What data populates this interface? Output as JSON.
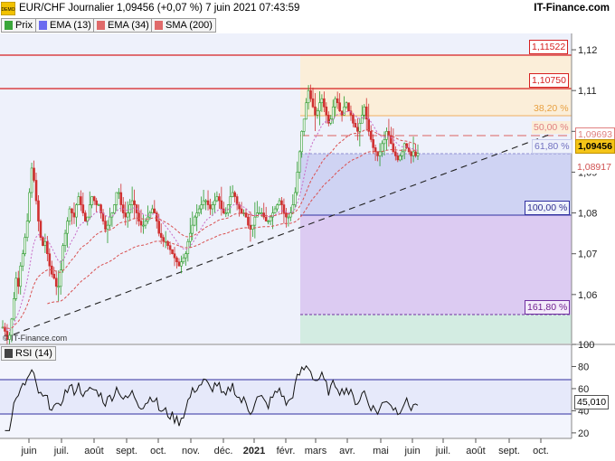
{
  "header": {
    "title": "EUR/CHF Journalier 1,09456 (+0,07 %) 7 juin 2021 07:43:59",
    "brand": "IT-Finance.com",
    "logo_text": "DEMO",
    "watermark": "© IT-Finance.com"
  },
  "legend": [
    {
      "label": "Prix",
      "color": "#3aa63a"
    },
    {
      "label": "EMA (13)",
      "color": "#6a6af0"
    },
    {
      "label": "EMA (34)",
      "color": "#e06a6a"
    },
    {
      "label": "SMA (200)",
      "color": "#e06a6a"
    }
  ],
  "rsi_legend": {
    "label": "RSI (14)"
  },
  "price_labels": {
    "high_1": "1,11522",
    "high_2": "1,10750",
    "fib_38": "38,20 %",
    "fib_50": "50,00 %",
    "fib_50_value": "1,09693",
    "fib_618": "61,80 %",
    "last_price": "1,09456",
    "sma_value": "1,08917",
    "fib_100": "100,00 %",
    "fib_1618": "161,80 %",
    "rsi_value": "45,010"
  },
  "chart_data": [
    {
      "type": "candlestick",
      "title": "EUR/CHF Journalier",
      "ylim": [
        1.048,
        1.124
      ],
      "y_ticks": [
        "1,12",
        "1,11",
        "1,1",
        "1,09",
        "1,08",
        "1,07",
        "1,06"
      ],
      "x_ticks": [
        "juin",
        "juil.",
        "août",
        "sept.",
        "oct.",
        "nov.",
        "déc.",
        "2021",
        "févr.",
        "mars",
        "avr.",
        "mai",
        "juin",
        "juil.",
        "août",
        "sept.",
        "oct."
      ],
      "horizontal_levels": [
        {
          "name": "resistance-1",
          "value": 1.11522,
          "color": "#e03030"
        },
        {
          "name": "resistance-2",
          "value": 1.1075,
          "color": "#e03030"
        },
        {
          "name": "fib-38",
          "value": 1.1015,
          "color": "#f0b060"
        },
        {
          "name": "fib-50",
          "value": 1.09693,
          "color": "#e08080"
        },
        {
          "name": "fib-61.8",
          "value": 1.0937,
          "color": "#9090d0"
        },
        {
          "name": "fib-100",
          "value": 1.0789,
          "color": "#4040a0"
        },
        {
          "name": "fib-161.8",
          "value": 1.0553,
          "color": "#8040a0"
        }
      ],
      "close_series": [
        1.052,
        1.051,
        1.049,
        1.05,
        1.054,
        1.059,
        1.064,
        1.062,
        1.067,
        1.07,
        1.074,
        1.078,
        1.085,
        1.091,
        1.088,
        1.083,
        1.078,
        1.074,
        1.072,
        1.073,
        1.07,
        1.067,
        1.065,
        1.064,
        1.062,
        1.062,
        1.066,
        1.072,
        1.075,
        1.078,
        1.081,
        1.08,
        1.079,
        1.082,
        1.084,
        1.082,
        1.08,
        1.078,
        1.079,
        1.082,
        1.084,
        1.083,
        1.082,
        1.082,
        1.08,
        1.078,
        1.076,
        1.077,
        1.079,
        1.08,
        1.082,
        1.085,
        1.085,
        1.082,
        1.08,
        1.079,
        1.08,
        1.082,
        1.083,
        1.082,
        1.08,
        1.078,
        1.077,
        1.077,
        1.078,
        1.079,
        1.08,
        1.081,
        1.08,
        1.078,
        1.075,
        1.074,
        1.073,
        1.073,
        1.072,
        1.071,
        1.07,
        1.069,
        1.068,
        1.067,
        1.068,
        1.069,
        1.07,
        1.073,
        1.075,
        1.077,
        1.079,
        1.08,
        1.081,
        1.082,
        1.083,
        1.083,
        1.082,
        1.081,
        1.082,
        1.083,
        1.084,
        1.083,
        1.081,
        1.08,
        1.08,
        1.082,
        1.084,
        1.085,
        1.084,
        1.082,
        1.081,
        1.08,
        1.08,
        1.079,
        1.077,
        1.076,
        1.077,
        1.079,
        1.08,
        1.08,
        1.08,
        1.079,
        1.078,
        1.078,
        1.079,
        1.08,
        1.081,
        1.082,
        1.083,
        1.082,
        1.08,
        1.079,
        1.079,
        1.08,
        1.082,
        1.085,
        1.09,
        1.095,
        1.1,
        1.103,
        1.107,
        1.11,
        1.108,
        1.106,
        1.104,
        1.105,
        1.107,
        1.108,
        1.106,
        1.104,
        1.102,
        1.103,
        1.106,
        1.108,
        1.107,
        1.105,
        1.104,
        1.106,
        1.107,
        1.105,
        1.104,
        1.102,
        1.101,
        1.1,
        1.102,
        1.104,
        1.106,
        1.103,
        1.1,
        1.098,
        1.096,
        1.095,
        1.094,
        1.095,
        1.097,
        1.098,
        1.1,
        1.099,
        1.097,
        1.095,
        1.094,
        1.093,
        1.094,
        1.095,
        1.097,
        1.096,
        1.095,
        1.094,
        1.095,
        1.094,
        1.0946
      ],
      "ema13_label": "EMA (13)",
      "ema34_label": "EMA (34)",
      "sma200_label": "SMA (200)",
      "sma200_last": 1.08917
    },
    {
      "type": "line",
      "title": "RSI (14)",
      "ylim": [
        15,
        100
      ],
      "y_ticks": [
        "100",
        "80",
        "60",
        "40",
        "20"
      ],
      "levels": [
        70,
        30
      ],
      "last_value": 45.01
    }
  ]
}
